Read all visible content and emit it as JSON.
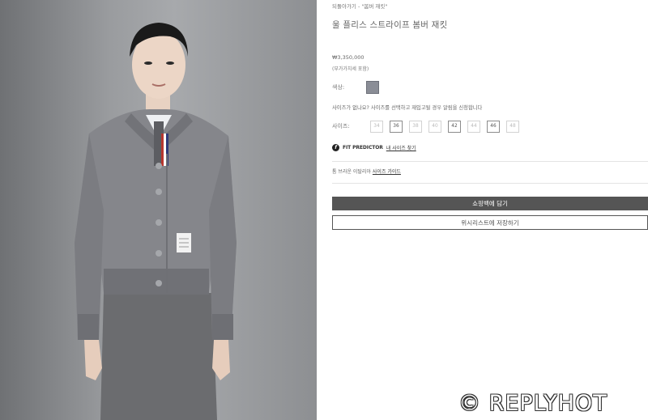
{
  "breadcrumb": "되돌아가기 - \"봄버 재킷\"",
  "product": {
    "title": "울 플리스 스트라이프 봄버 재킷",
    "price": "₩3,350,000",
    "vat_note": "(부가가치세 포함)"
  },
  "color": {
    "label": "색상:",
    "swatch_hex": "#8a8d96"
  },
  "size_note": "사이즈가 없나요? 사이즈를 선택하고 재입고될 경우 알림을 신청합니다",
  "sizes": {
    "label": "사이즈:",
    "options": [
      {
        "label": "34",
        "available": false
      },
      {
        "label": "36",
        "available": true
      },
      {
        "label": "38",
        "available": false
      },
      {
        "label": "40",
        "available": false
      },
      {
        "label": "42",
        "available": true
      },
      {
        "label": "44",
        "available": false
      },
      {
        "label": "46",
        "available": true
      },
      {
        "label": "48",
        "available": false
      }
    ]
  },
  "fit_predictor": {
    "label": "FIT PREDICTOR",
    "link": "내 사이즈 찾기"
  },
  "origin": {
    "text": "톰 브라운 이탈리아",
    "link": "사이즈 가이드"
  },
  "buttons": {
    "add_to_bag": "쇼핑백에 담기",
    "wishlist": "위시리스트에 저장하기"
  },
  "watermark": "© REPLYHOT"
}
